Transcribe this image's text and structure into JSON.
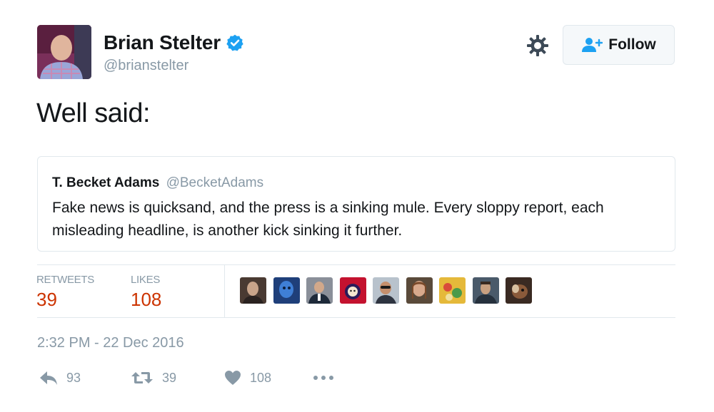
{
  "author": {
    "name": "Brian Stelter",
    "handle": "@brianstelter",
    "verified": true
  },
  "follow_button": {
    "label": "Follow"
  },
  "tweet": {
    "text": "Well said:"
  },
  "quoted_tweet": {
    "name": "T. Becket Adams",
    "handle": "@BecketAdams",
    "text": "Fake news is quicksand, and the press is a sinking mule. Every sloppy report, each misleading headline, is another kick sinking it further."
  },
  "stats": {
    "retweets_label": "RETWEETS",
    "retweets_value": "39",
    "likes_label": "LIKES",
    "likes_value": "108"
  },
  "timestamp": "2:32 PM - 22 Dec 2016",
  "actions": {
    "reply_count": "93",
    "retweet_count": "39",
    "like_count": "108"
  },
  "colors": {
    "verified_blue": "#1da1f2",
    "stat_value_red": "#cc3300",
    "muted_gray": "#8899a6"
  }
}
